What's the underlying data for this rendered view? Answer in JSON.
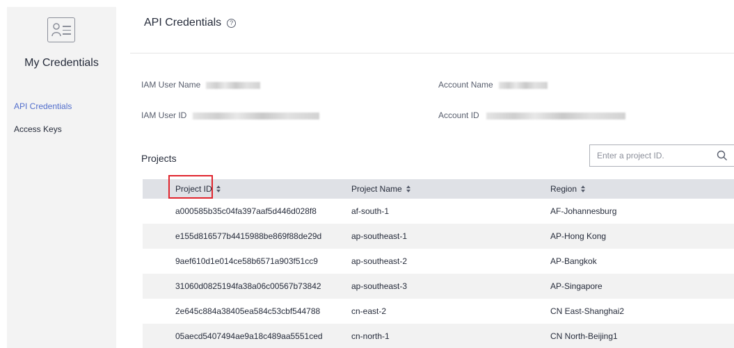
{
  "sidebar": {
    "title": "My Credentials",
    "items": [
      {
        "label": "API Credentials",
        "active": true
      },
      {
        "label": "Access Keys",
        "active": false
      }
    ]
  },
  "header": {
    "title": "API Credentials",
    "help_icon": "question-circle-icon"
  },
  "info": {
    "iam_user_name_label": "IAM User Name",
    "account_name_label": "Account Name",
    "iam_user_id_label": "IAM User ID",
    "account_id_label": "Account ID"
  },
  "projects": {
    "label": "Projects",
    "search_placeholder": "Enter a project ID.",
    "columns": [
      "Project ID",
      "Project Name",
      "Region"
    ],
    "rows": [
      {
        "id": "a000585b35c04fa397aaf5d446d028f8",
        "name": "af-south-1",
        "region": "AF-Johannesburg"
      },
      {
        "id": "e155d816577b4415988be869f88de29d",
        "name": "ap-southeast-1",
        "region": "AP-Hong Kong"
      },
      {
        "id": "9aef610d1e014ce58b6571a903f51cc9",
        "name": "ap-southeast-2",
        "region": "AP-Bangkok"
      },
      {
        "id": "31060d0825194fa38a06c00567b73842",
        "name": "ap-southeast-3",
        "region": "AP-Singapore"
      },
      {
        "id": "2e645c884a38405ea584c53cbf544788",
        "name": "cn-east-2",
        "region": "CN East-Shanghai2"
      },
      {
        "id": "05aecd5407494ae9a18c489aa5551ced",
        "name": "cn-north-1",
        "region": "CN North-Beijing1"
      }
    ]
  },
  "colors": {
    "accent": "#526ecc",
    "highlight": "#e0242d",
    "header_bg": "#dfe1e6",
    "sidebar_bg": "#f3f3f3"
  }
}
